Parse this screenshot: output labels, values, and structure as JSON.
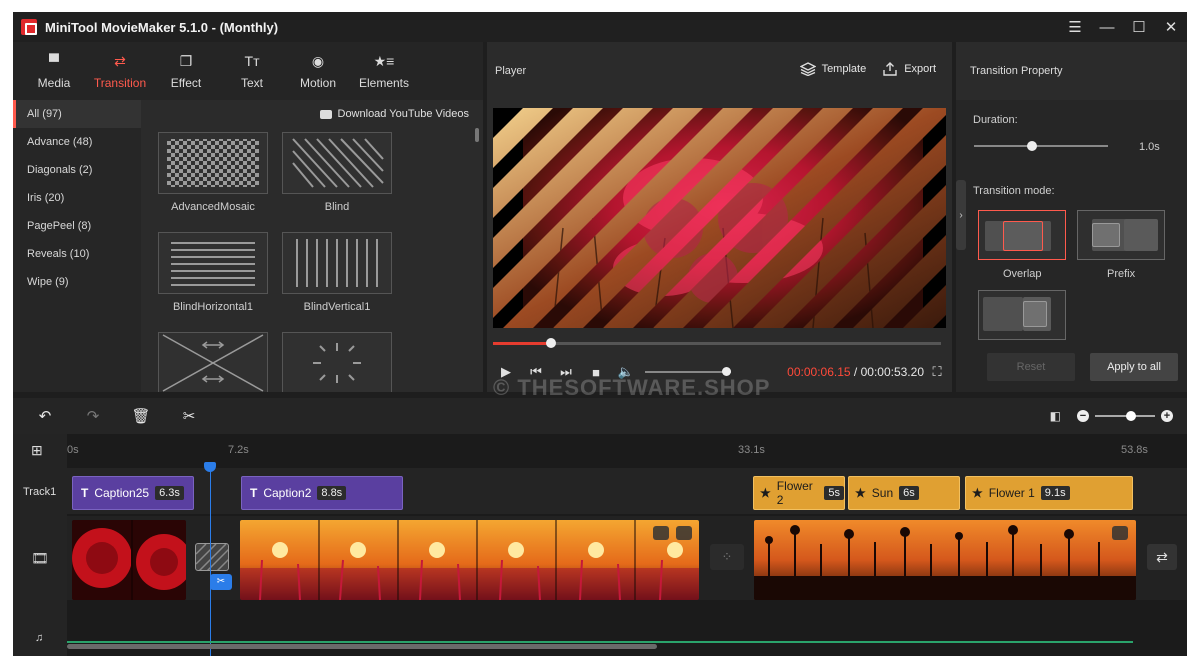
{
  "app": {
    "title": "MiniTool MovieMaker 5.1.0 - (Monthly)"
  },
  "window_controls": {
    "menu": "☰",
    "minimize": "—",
    "maximize": "☐",
    "close": "✕"
  },
  "tabs": [
    {
      "label": "Media",
      "icon": "▀"
    },
    {
      "label": "Transition",
      "icon": "⇄"
    },
    {
      "label": "Effect",
      "icon": "❐"
    },
    {
      "label": "Text",
      "icon": "Tт"
    },
    {
      "label": "Motion",
      "icon": "◉"
    },
    {
      "label": "Elements",
      "icon": "★≡"
    }
  ],
  "categories": [
    "All (97)",
    "Advance (48)",
    "Diagonals (2)",
    "Iris (20)",
    "PagePeel (8)",
    "Reveals (10)",
    "Wipe (9)"
  ],
  "download_label": "Download YouTube Videos",
  "transitions": [
    "AdvancedMosaic",
    "Blind",
    "BlindHorizontal1",
    "BlindVertical1"
  ],
  "player": {
    "title": "Player",
    "template_label": "Template",
    "export_label": "Export",
    "progress": 0.13,
    "current_time": "00:00:06.15",
    "separator": " / ",
    "total_time": "00:00:53.20"
  },
  "watermark": "© THESOFTWARE.SHOP",
  "property": {
    "title": "Transition Property",
    "duration_label": "Duration:",
    "duration_value": "1.0s",
    "duration_fraction": 0.43,
    "mode_label": "Transition mode:",
    "modes": [
      "Overlap",
      "Prefix"
    ],
    "reset_label": "Reset",
    "apply_label": "Apply to all"
  },
  "timeline": {
    "ruler": [
      "0s",
      "7.2s",
      "33.1s",
      "53.8s"
    ],
    "track_label": "Track1",
    "captions": [
      {
        "name": "Caption25",
        "duration": "6.3s"
      },
      {
        "name": "Caption2",
        "duration": "8.8s"
      }
    ],
    "elements": [
      {
        "name": "Flower 2",
        "duration": "5s"
      },
      {
        "name": "Sun",
        "duration": "6s"
      },
      {
        "name": "Flower 1",
        "duration": "9.1s"
      }
    ],
    "zoom_fraction": 0.6
  },
  "colors": {
    "accent": "#ff5a4d",
    "playhead": "#2b7de9",
    "caption_purple": "#5a3fa0",
    "element_orange": "#e0a032"
  }
}
